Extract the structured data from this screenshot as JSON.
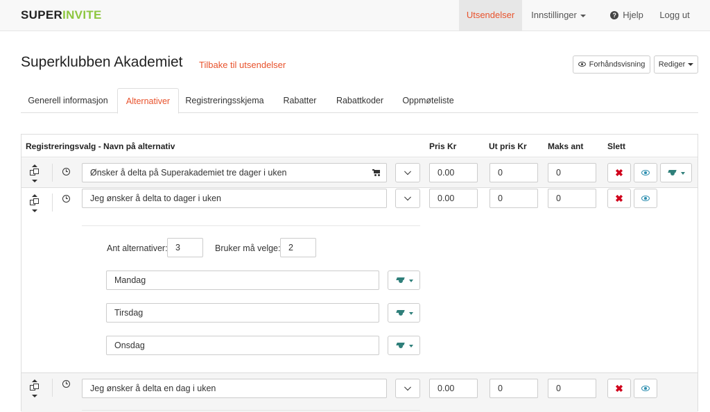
{
  "navbar": {
    "logo_part1": "SUPER",
    "logo_part2": "INVITE",
    "items": [
      {
        "label": "Utsendelser",
        "active": true
      },
      {
        "label": "Innstillinger"
      },
      {
        "label": "Hjelp",
        "icon": "question-circle-icon"
      },
      {
        "label": "Logg ut"
      }
    ]
  },
  "header": {
    "title": "Superklubben Akademiet",
    "back_link": "Tilbake til utsendelser",
    "preview_button": "Forhåndsvisning",
    "edit_button": "Rediger"
  },
  "tabs": [
    {
      "label": "Generell informasjon"
    },
    {
      "label": "Alternativer",
      "active": true
    },
    {
      "label": "Registreringsskjema"
    },
    {
      "label": "Rabatter"
    },
    {
      "label": "Rabattkoder"
    },
    {
      "label": "Oppmøteliste"
    }
  ],
  "table": {
    "headers": {
      "name": "Registreringsvalg - Navn på alternativ",
      "price": "Pris Kr",
      "out_price": "Ut pris Kr",
      "max": "Maks ant",
      "delete": "Slett"
    },
    "rows": [
      {
        "name": "Ønsker å delta på Superakademiet tre dager i uken",
        "price": "0.00",
        "out_price": "0",
        "max": "0"
      },
      {
        "name": "Jeg ønsker å delta to dager i uken",
        "price": "0.00",
        "out_price": "0",
        "max": "0"
      },
      {
        "name": "Jeg ønsker å delta en dag i uken",
        "price": "0.00",
        "out_price": "0",
        "max": "0"
      }
    ],
    "sub_options": {
      "count_label": "Ant alternativer:",
      "count_value": "3",
      "must_choose_label": "Bruker må velge:",
      "must_choose_value": "2",
      "items": [
        "Mandag",
        "Tirsdag",
        "Onsdag"
      ]
    }
  },
  "colors": {
    "accent": "#e8522c",
    "logo_green": "#8dc63f",
    "delete_red": "#d0021b",
    "icon_teal": "#2f7f7a",
    "eye_blue": "#2f8fb0"
  }
}
